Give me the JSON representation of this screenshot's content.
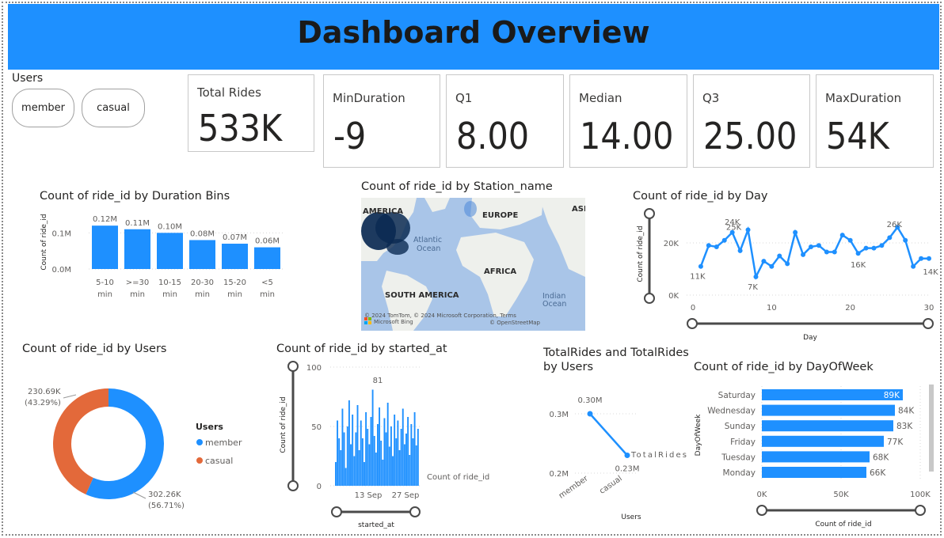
{
  "header": {
    "title": "Dashboard Overview"
  },
  "slicer": {
    "title": "Users",
    "options": [
      "member",
      "casual"
    ]
  },
  "kpis": [
    {
      "label": "Total Rides",
      "value": "533K"
    },
    {
      "label": "MinDuration",
      "value": "-9"
    },
    {
      "label": "Q1",
      "value": "8.00"
    },
    {
      "label": "Median",
      "value": "14.00"
    },
    {
      "label": "Q3",
      "value": "25.00"
    },
    {
      "label": "MaxDuration",
      "value": "54K"
    }
  ],
  "map": {
    "title": "Count of ride_id by Station_name",
    "labels": [
      "AMERICA",
      "EUROPE",
      "ASI",
      "Atlantic",
      "Ocean",
      "AFRICA",
      "SOUTH AMERICA",
      "Indian",
      "Ocean"
    ],
    "attribution": "© 2024 TomTom, © 2024 Microsoft Corporation, Terms",
    "attribution2": "© OpenStreetMap",
    "bing": "Microsoft Bing"
  },
  "chart_data": [
    {
      "type": "bar",
      "title": "Count of ride_id by Duration Bins",
      "ylabel": "Count of ride_id",
      "categories": [
        "5-10 min",
        ">=30 min",
        "10-15 min",
        "20-30 min",
        "15-20 min",
        "<5 min"
      ],
      "values": [
        0.12,
        0.11,
        0.1,
        0.08,
        0.07,
        0.06
      ],
      "data_labels": [
        "0.12M",
        "0.11M",
        "0.10M",
        "0.08M",
        "0.07M",
        "0.06M"
      ],
      "yticks": [
        "0.0M",
        "0.1M"
      ],
      "ylim": [
        0,
        0.14
      ],
      "color": "#1E90FF"
    },
    {
      "type": "line",
      "title": "Count of ride_id by Day",
      "xlabel": "Day",
      "ylabel": "Count of ride_id",
      "x": [
        1,
        2,
        3,
        4,
        5,
        6,
        7,
        8,
        9,
        10,
        11,
        12,
        13,
        14,
        15,
        16,
        17,
        18,
        19,
        20,
        21,
        22,
        23,
        24,
        25,
        26,
        27,
        28,
        29,
        30
      ],
      "values": [
        11000,
        19000,
        18500,
        21000,
        24000,
        17000,
        25000,
        7000,
        13000,
        11000,
        15000,
        12000,
        24000,
        15500,
        18500,
        19000,
        16500,
        16500,
        23000,
        21000,
        16000,
        18000,
        18000,
        19000,
        22000,
        26000,
        21000,
        11000,
        14000,
        14000
      ],
      "data_labels": [
        "11K",
        "24K",
        "25K",
        "7K",
        "16K",
        "26K",
        "14K"
      ],
      "yticks": [
        "0K",
        "20K"
      ],
      "xticks": [
        "0",
        "10",
        "20",
        "30"
      ],
      "ylim": [
        0,
        30000
      ],
      "color": "#1E90FF"
    },
    {
      "type": "pie",
      "title": "Count of ride_id by Users",
      "legend_title": "Users",
      "categories": [
        "member",
        "casual"
      ],
      "values": [
        302.26,
        230.69
      ],
      "data_labels": [
        "302.26K",
        "230.69K"
      ],
      "percent_labels": [
        "(56.71%)",
        "(43.29%)"
      ],
      "colors": [
        "#1E90FF",
        "#E3693A"
      ]
    },
    {
      "type": "bar",
      "title": "Count of ride_id by started_at",
      "xlabel": "started_at",
      "ylabel": "Count of ride_id",
      "legend": "Count of ride_id",
      "yticks": [
        "0",
        "50",
        "100"
      ],
      "xticks": [
        "13 Sep",
        "27 Sep"
      ],
      "peak_label": "81",
      "ylim": [
        0,
        100
      ],
      "values": [
        20,
        55,
        40,
        30,
        65,
        45,
        15,
        50,
        72,
        35,
        60,
        25,
        45,
        68,
        30,
        55,
        40,
        20,
        62,
        48,
        35,
        58,
        81,
        42,
        28,
        52,
        66,
        38,
        22,
        57,
        45,
        70,
        33,
        50,
        25,
        60,
        40,
        55,
        30,
        48,
        65,
        35,
        44,
        58,
        26,
        52,
        40,
        62,
        34,
        48
      ],
      "color": "#1E90FF"
    },
    {
      "type": "line",
      "title": "TotalRides and TotalRides by Users",
      "xlabel": "Users",
      "categories": [
        "member",
        "casual"
      ],
      "values": [
        0.3,
        0.23
      ],
      "data_labels": [
        "0.30M",
        "0.23M"
      ],
      "yticks": [
        "0.2M",
        "0.3M"
      ],
      "legend": "TotalRides",
      "ylim": [
        0.19,
        0.34
      ],
      "color": "#1E90FF"
    },
    {
      "type": "bar",
      "title": "Count of ride_id by DayOfWeek",
      "xlabel": "Count of ride_id",
      "ylabel": "DayOfWeek",
      "categories": [
        "Saturday",
        "Wednesday",
        "Sunday",
        "Friday",
        "Tuesday",
        "Monday"
      ],
      "values": [
        89,
        84,
        83,
        77,
        68,
        66
      ],
      "data_labels": [
        "89K",
        "84K",
        "83K",
        "77K",
        "68K",
        "66K"
      ],
      "xticks": [
        "0K",
        "50K",
        "100K"
      ],
      "xlim": [
        0,
        100
      ],
      "color": "#1E90FF"
    }
  ]
}
